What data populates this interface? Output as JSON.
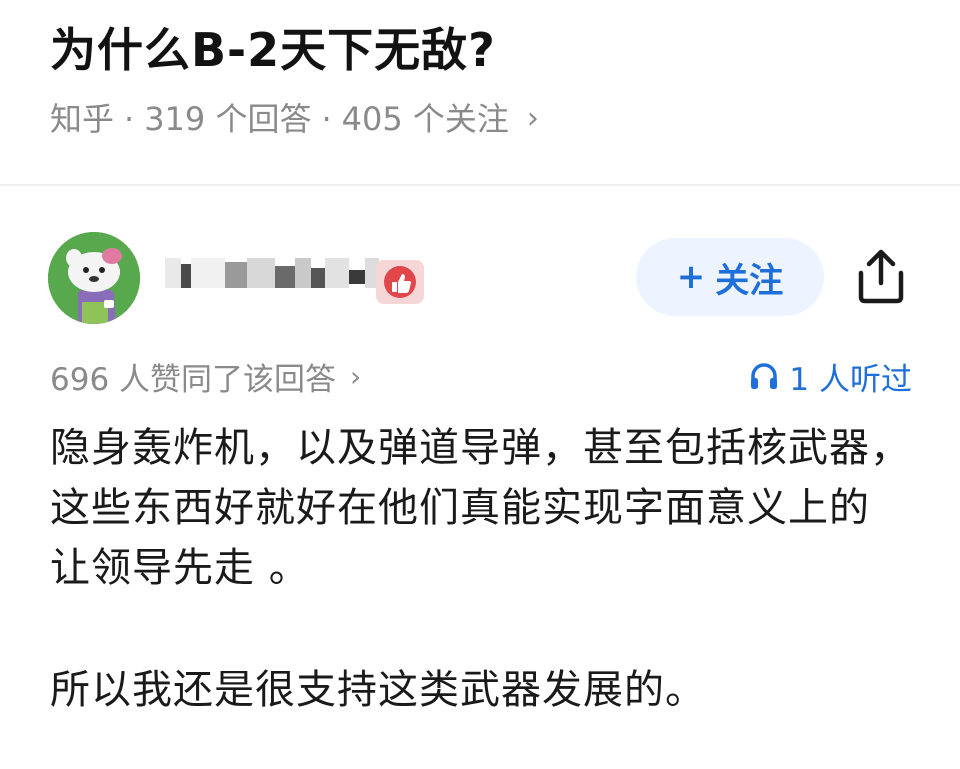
{
  "question": {
    "title": "为什么B-2天下无敌?",
    "source": "知乎",
    "answers_count": "319 个回答",
    "followers_count": "405 个关注",
    "meta_chevron": "›",
    "separator": "·"
  },
  "author": {
    "avatar_icon": "cartoon-avatar-icon",
    "name_obscured": true,
    "badge_icon": "thumbs-up-badge-icon"
  },
  "actions": {
    "follow_label": "关注",
    "follow_prefix": "+",
    "share_icon": "share-icon"
  },
  "stats": {
    "likes_text": "696 人赞同了该回答",
    "likes_chevron": "›",
    "listen_icon": "headphones-icon",
    "listens_text": "1 人听过"
  },
  "answer": {
    "paragraph_1": "隐身轰炸机，以及弹道导弹，甚至包括核武器，这些东西好就好在他们真能实现字面意义上的 让领导先走 。",
    "paragraph_2": "所以我还是很支持这类武器发展的。"
  },
  "colors": {
    "accent": "#1e6fd9",
    "follow_bg": "#eef4ff",
    "meta_gray": "#8a8a8a",
    "avatar_green": "#58a84e",
    "badge_red": "#e0464a"
  }
}
